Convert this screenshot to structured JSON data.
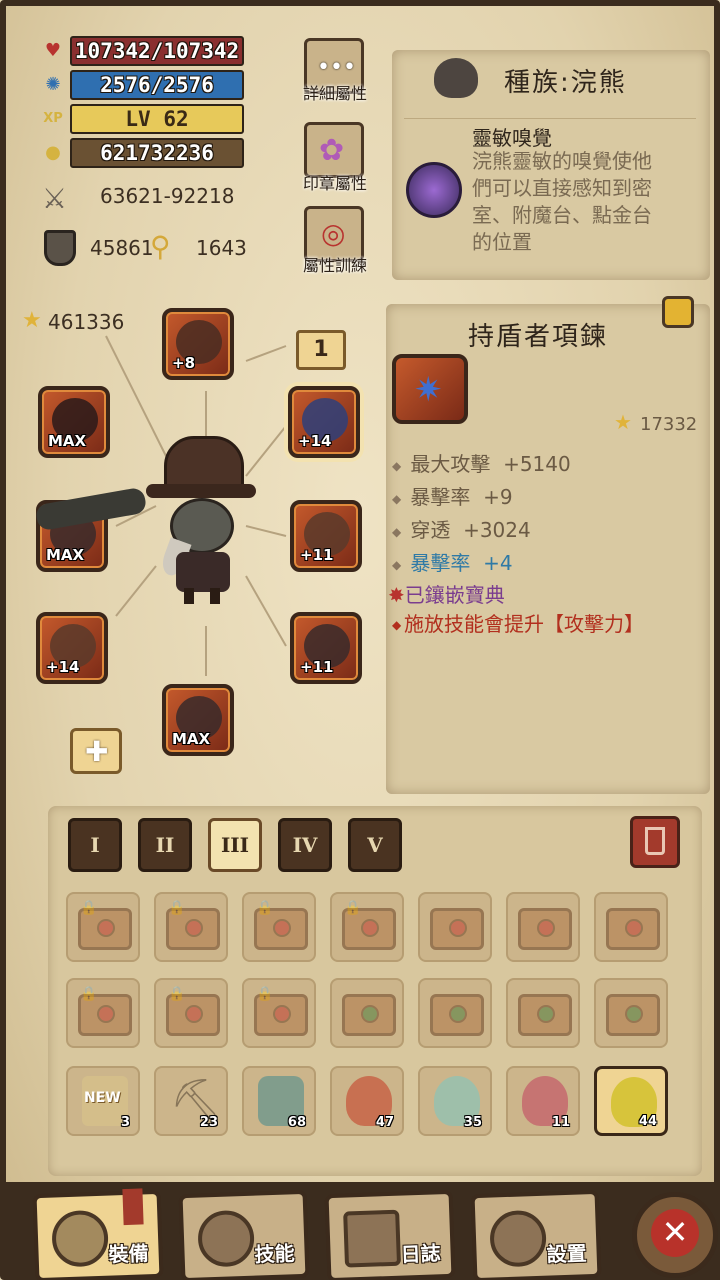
{
  "stats": {
    "hp": "107342/107342",
    "mp": "2576/2576",
    "level": "LV 62",
    "gold": "621732236",
    "attack_range": "63621-92218",
    "defense": "45861",
    "keys": "1643",
    "power": "461336"
  },
  "side_buttons": {
    "details": "詳細屬性",
    "seal": "印章屬性",
    "training": "屬性訓練"
  },
  "race": {
    "title": "種族:浣熊",
    "skill_name": "靈敏嗅覺",
    "skill_desc": "浣熊靈敏的嗅覺使他們可以直接感知到密室、附魔台、點金台的位置"
  },
  "item": {
    "name": "持盾者項鍊",
    "score": "17332",
    "level_badge": "1",
    "stats": [
      {
        "label": "最大攻擊",
        "value": "+5140"
      },
      {
        "label": "暴擊率",
        "value": "+9"
      },
      {
        "label": "穿透",
        "value": "+3024"
      }
    ],
    "bonus": {
      "label": "暴擊率",
      "value": "+4"
    },
    "inlaid": "已鑲嵌寶典",
    "effect": "施放技能會提升【攻擊力】"
  },
  "equipment": [
    {
      "slot": "helmet",
      "badge": "+8"
    },
    {
      "slot": "mask",
      "badge": "MAX"
    },
    {
      "slot": "weapon",
      "badge": "MAX"
    },
    {
      "slot": "gloves",
      "badge": "+14"
    },
    {
      "slot": "boots",
      "badge": "MAX"
    },
    {
      "slot": "necklace",
      "badge": "+14"
    },
    {
      "slot": "armor",
      "badge": "+11"
    },
    {
      "slot": "legs",
      "badge": "+11"
    }
  ],
  "tabs": [
    "I",
    "II",
    "III",
    "IV",
    "V"
  ],
  "selected_tab": "III",
  "inventory_consumables": [
    {
      "name": "new-scroll",
      "qty": "3",
      "color": "#d9c48a",
      "label": "NEW"
    },
    {
      "name": "pickaxe",
      "qty": "23",
      "color": "#9a8a70"
    },
    {
      "name": "eye-map",
      "qty": "68",
      "color": "#4f8e8e"
    },
    {
      "name": "red-potion",
      "qty": "47",
      "color": "#c4432b"
    },
    {
      "name": "cyan-potion",
      "qty": "35",
      "color": "#7fc6c0"
    },
    {
      "name": "pink-potion",
      "qty": "11",
      "color": "#c14a63"
    },
    {
      "name": "yellow-potion",
      "qty": "44",
      "color": "#d7c43b"
    }
  ],
  "nav": {
    "equip": "裝備",
    "skill": "技能",
    "log": "日誌",
    "settings": "設置"
  },
  "colors": {
    "hp_bar": "#8a2f2f",
    "mp_bar": "#2f6fb0",
    "xp_bar": "#e7c95a",
    "gold_bar": "#6a5133",
    "bonus_text": "#2f7aa6",
    "inlaid_text": "#7a3d8f",
    "effect_text": "#b22f1e"
  }
}
